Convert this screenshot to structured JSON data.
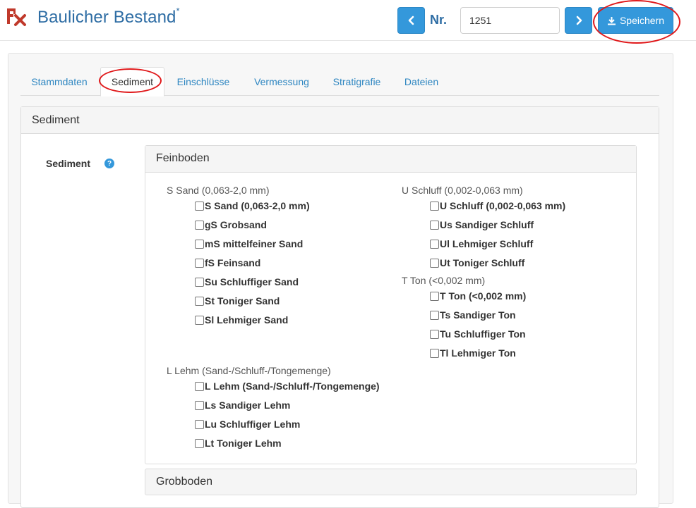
{
  "header": {
    "title": "Baulicher Bestand",
    "modified_marker": "*",
    "nr_label": "Nr.",
    "nr_value": "1251",
    "save_label": "Speichern"
  },
  "tabs": [
    {
      "label": "Stammdaten"
    },
    {
      "label": "Sediment"
    },
    {
      "label": "Einschlüsse"
    },
    {
      "label": "Vermessung"
    },
    {
      "label": "Stratigrafie"
    },
    {
      "label": "Dateien"
    }
  ],
  "sediment_panel": {
    "title": "Sediment",
    "field_label": "Sediment",
    "help_icon": "?",
    "feinboden": {
      "title": "Feinboden",
      "groups": {
        "sand": {
          "title": "S Sand (0,063-2,0 mm)",
          "items": [
            "S Sand (0,063-2,0 mm)",
            "gS Grobsand",
            "mS mittelfeiner Sand",
            "fS Feinsand",
            "Su Schluffiger Sand",
            "St Toniger Sand",
            "Sl Lehmiger Sand"
          ]
        },
        "schluff": {
          "title": "U Schluff (0,002-0,063 mm)",
          "items": [
            "U Schluff (0,002-0,063 mm)",
            "Us Sandiger Schluff",
            "Ul Lehmiger Schluff",
            "Ut Toniger Schluff"
          ]
        },
        "ton": {
          "title": "T Ton (<0,002 mm)",
          "items": [
            "T Ton (<0,002 mm)",
            "Ts Sandiger Ton",
            "Tu Schluffiger Ton",
            "Tl Lehmiger Ton"
          ]
        },
        "lehm": {
          "title": "L Lehm (Sand-/Schluff-/Tongemenge)",
          "items": [
            "L Lehm (Sand-/Schluff-/Tongemenge)",
            "Ls Sandiger Lehm",
            "Lu Schluffiger Lehm",
            "Lt Toniger Lehm"
          ]
        }
      }
    },
    "grobboden": {
      "title": "Grobboden"
    }
  },
  "colors": {
    "accent": "#3498db",
    "title": "#2e6da4",
    "link": "#2e86c1",
    "highlight": "#e0191b"
  },
  "icons": {
    "logo": "app-logo-icon",
    "prev": "chevron-left-icon",
    "next": "chevron-right-icon",
    "save": "download-icon",
    "help": "question-circle-icon"
  }
}
